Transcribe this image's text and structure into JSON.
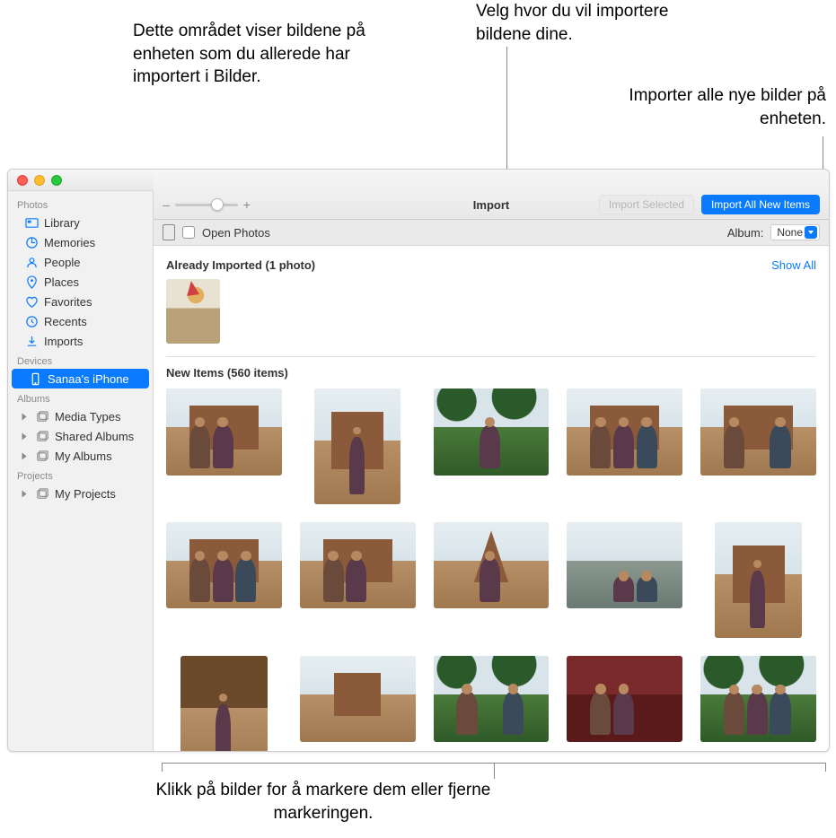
{
  "callouts": {
    "top_left": "Dette området viser bildene på enheten som du allerede har importert i Bilder.",
    "top_right_1": "Velg hvor du vil importere bildene dine.",
    "top_right_2": "Importer alle nye bilder på enheten.",
    "bottom": "Klikk på bilder for å markere dem eller fjerne markeringen."
  },
  "sidebar": {
    "groups": [
      {
        "header": "Photos",
        "items": [
          {
            "icon": "library",
            "label": "Library"
          },
          {
            "icon": "memories",
            "label": "Memories"
          },
          {
            "icon": "people",
            "label": "People"
          },
          {
            "icon": "places",
            "label": "Places"
          },
          {
            "icon": "favorites",
            "label": "Favorites"
          },
          {
            "icon": "recents",
            "label": "Recents"
          },
          {
            "icon": "imports",
            "label": "Imports"
          }
        ]
      },
      {
        "header": "Devices",
        "items": [
          {
            "icon": "phone",
            "label": "Sanaa's iPhone",
            "selected": true
          }
        ]
      },
      {
        "header": "Albums",
        "items": [
          {
            "icon": "album",
            "label": "Media Types",
            "disclosure": true
          },
          {
            "icon": "album",
            "label": "Shared Albums",
            "disclosure": true
          },
          {
            "icon": "album",
            "label": "My Albums",
            "disclosure": true
          }
        ]
      },
      {
        "header": "Projects",
        "items": [
          {
            "icon": "album",
            "label": "My Projects",
            "disclosure": true
          }
        ]
      }
    ]
  },
  "toolbar": {
    "title": "Import",
    "import_selected": "Import Selected",
    "import_all": "Import All New Items",
    "zoom_minus": "–",
    "zoom_plus": "+"
  },
  "subbar": {
    "open_photos": "Open Photos",
    "album_label": "Album:",
    "album_value": "None"
  },
  "sections": {
    "already_imported": "Already Imported (1 photo)",
    "show_all": "Show All",
    "new_items": "New Items (560 items)"
  }
}
